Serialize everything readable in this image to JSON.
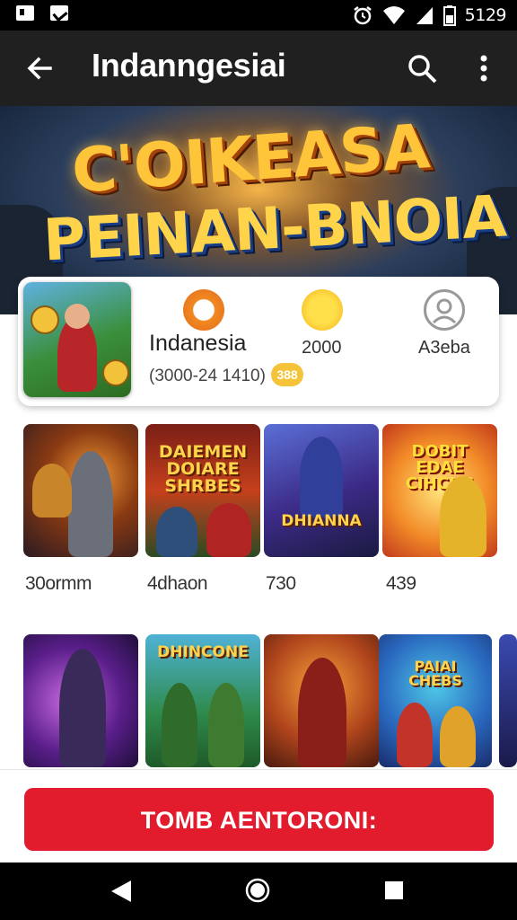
{
  "status_bar": {
    "time": "5129"
  },
  "app_bar": {
    "title": "Indanngesiai"
  },
  "banner": {
    "line1": "C'OIKEASA",
    "line2": "PEINAN-BNOIA"
  },
  "featured": {
    "name": "Indanesia",
    "subtitle": "(3000-24 1410)",
    "badge": "388",
    "stats": [
      {
        "icon": "coin-logo-icon",
        "value": ""
      },
      {
        "icon": "gold-coin-icon",
        "value": "2000"
      },
      {
        "icon": "user-icon",
        "value": "A3eba"
      }
    ]
  },
  "games_row1": [
    {
      "caption": "",
      "label": "30ormm"
    },
    {
      "caption": "DAIEMEN DOIARE SHRBES",
      "label": "4dhaon"
    },
    {
      "caption": "DHIANNA",
      "label": "730"
    },
    {
      "caption": "DOBIT EDAE CIHCHS",
      "label": "439"
    }
  ],
  "games_row2": [
    {
      "caption": ""
    },
    {
      "caption": "DHINCONE"
    },
    {
      "caption": ""
    },
    {
      "caption": "PAIAI CHEBS"
    },
    {
      "caption": ""
    }
  ],
  "cta": {
    "label": "TOMB AENTORONI:"
  },
  "colors": {
    "accent": "#e21b2d",
    "app_bar": "#202020"
  }
}
